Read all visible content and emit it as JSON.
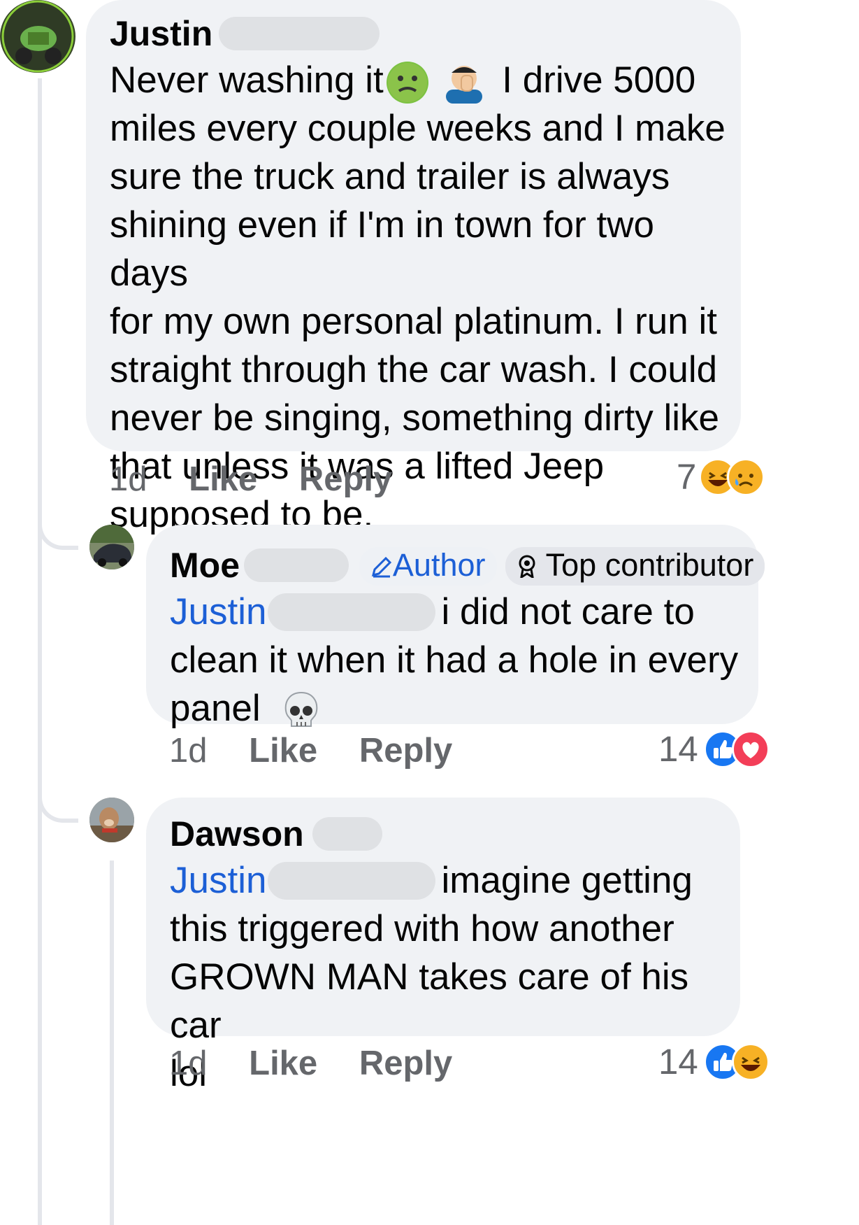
{
  "comments": [
    {
      "author": "Justin",
      "text_line1_a": "Never washing it",
      "text_line1_b": "I drive 5000",
      "text_lines": [
        "miles every couple weeks and I make",
        "sure the truck and trailer is always",
        "shining even if I'm in town for two days",
        "for my own personal platinum. I run it",
        "straight through the car wash. I could",
        "never be singing, something dirty like",
        "that unless it was a lifted Jeep",
        "supposed to be."
      ],
      "emojis": [
        "nauseated-face-icon",
        "facepalm-icon"
      ],
      "time": "1d",
      "like_label": "Like",
      "reply_label": "Reply",
      "reaction_count": "7",
      "reactions": [
        "haha-icon",
        "sad-icon"
      ]
    },
    {
      "author": "Moe",
      "badges": {
        "author": "Author",
        "top": "Top contributor"
      },
      "mention": "Justin",
      "text_line1": "i did not care to",
      "text_lines": [
        "clean it when it had a hole in every",
        "panel"
      ],
      "emojis": [
        "skull-icon"
      ],
      "time": "1d",
      "like_label": "Like",
      "reply_label": "Reply",
      "reaction_count": "14",
      "reactions": [
        "like-icon",
        "love-icon"
      ]
    },
    {
      "author": "Dawson",
      "mention": "Justin",
      "text_line1": "imagine getting",
      "text_lines": [
        "this triggered with how another",
        "GROWN MAN takes care of his car",
        "lol"
      ],
      "time": "1d",
      "like_label": "Like",
      "reply_label": "Reply",
      "reaction_count": "14",
      "reactions": [
        "like-icon",
        "haha-icon"
      ]
    }
  ],
  "colors": {
    "bubble": "#f0f2f5",
    "mention": "#1c5fd6",
    "meta": "#65676b",
    "like": "#1877f2",
    "love": "#f33e58",
    "haha": "#f7b125"
  }
}
